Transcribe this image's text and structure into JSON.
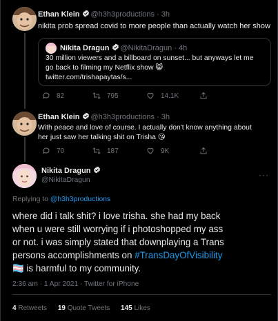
{
  "tweets": [
    {
      "name": "Ethan Klein",
      "handle": "@h3h3productions · 3h",
      "text": "nikita prob spread covid to more people than actually watch her show",
      "quote": {
        "name": "Nikita Dragun",
        "handle": "@NikitaDragun · 4h",
        "line1": "30 million viewers and a billboard on sunset... but anyways let me",
        "line2": "go back to filming my Netflix show 😸",
        "line3": "twitter.com/trishapaytas/s..."
      },
      "replies": "82",
      "retweets": "795",
      "likes": "14.1K"
    },
    {
      "name": "Ethan Klein",
      "handle": "@h3h3productions · 3h",
      "line1": "With peace and love of course. I actually don't know anything about",
      "line2": "her just saw her talking shit on Trisha 😘",
      "replies": "70",
      "retweets": "187",
      "likes": "9K"
    }
  ],
  "main": {
    "name": "Nikita Dragun",
    "handle": "@NikitaDragun",
    "replying_prefix": "Replying to ",
    "replying_to": "@h3h3productions",
    "line1": "where did i talk shit? i love trisha. she had my back",
    "line2": "when u were still worrying if i photoshopped my ass",
    "line3": "or not. i was simply stated that downplaying a Trans",
    "line4_pre": "persons accomplishments on ",
    "hashtag": "#TransDayOfVisibility",
    "line5_post": " is harmful to my community.",
    "flag": "🏳️‍⚧️",
    "meta": "2:36 am · 1 Apr 2021 · Twitter for iPhone",
    "retweets_count": "4",
    "retweets_label": "Retweets",
    "quotes_count": "19",
    "quotes_label": "Quote Tweets",
    "likes_count": "145",
    "likes_label": "Likes"
  },
  "colors": {
    "accent": "#1d9bf0",
    "background": "#000000",
    "muted": "#71767b",
    "border": "#2f3336"
  }
}
